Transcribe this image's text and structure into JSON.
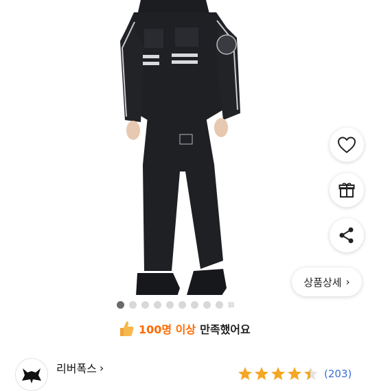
{
  "product": {
    "image_alt": "Black insulated coverall worn by model",
    "detail_button_label": "상품상세",
    "detail_chevron": "›",
    "slide_count": 10,
    "active_slide": 1
  },
  "actions": {
    "like_icon": "heart-outline",
    "gift_icon": "gift-box",
    "share_icon": "share-nodes"
  },
  "satisfaction": {
    "icon": "thumbs-up",
    "highlight": "100명 이상",
    "rest": "만족했어요"
  },
  "store": {
    "name": "리버폭스",
    "chevron": "›",
    "logo_icon": "fox-silhouette"
  },
  "rating": {
    "stars": 4.5,
    "max": 5,
    "review_count": "(203)"
  },
  "colors": {
    "accent_orange": "#ff6a00",
    "star": "#f5a623",
    "link_blue": "#3a6fd8"
  }
}
